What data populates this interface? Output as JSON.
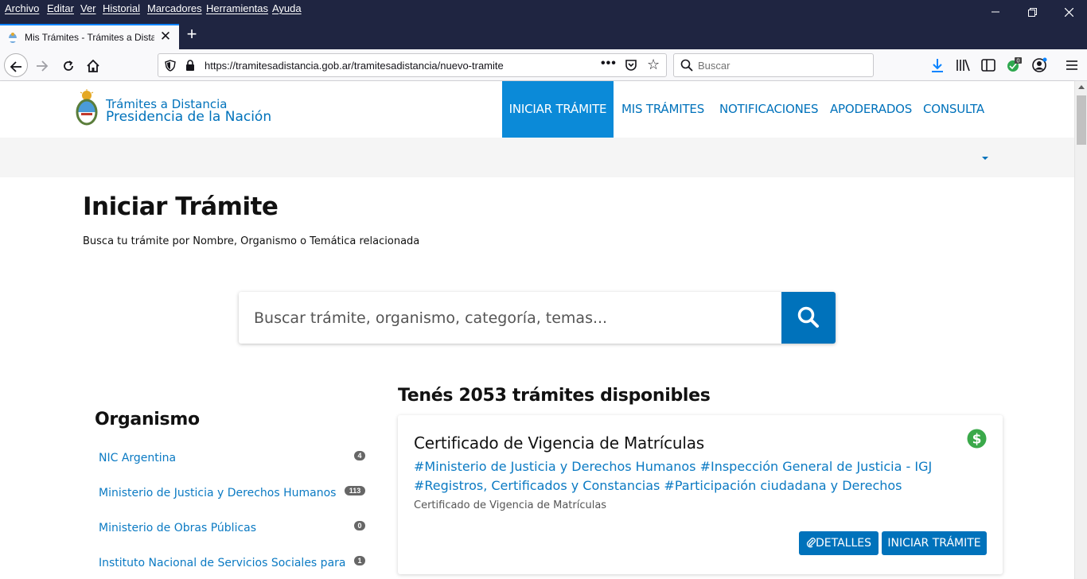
{
  "browser": {
    "menu": [
      "Archivo",
      "Editar",
      "Ver",
      "Historial",
      "Marcadores",
      "Herramientas",
      "Ayuda"
    ],
    "tab_title": "Mis Trámites - Trámites a Distancia",
    "url": "https://tramitesadistancia.gob.ar/tramitesadistancia/nuevo-tramite",
    "search_placeholder": "Buscar",
    "icons": [
      "back-icon",
      "forward-icon",
      "reload-icon",
      "home-icon",
      "shield-icon",
      "lock-icon",
      "pocket-icon",
      "star-icon",
      "download-icon",
      "library-icon",
      "sidebar-icon",
      "extension-icon",
      "account-icon",
      "menu-icon"
    ]
  },
  "header": {
    "logo_line1": "Trámites a Distancia",
    "logo_line2": "Presidencia de la Nación",
    "nav": [
      "INICIAR TRÁMITE",
      "MIS TRÁMITES",
      "NOTIFICACIONES",
      "APODERADOS",
      "CONSULTA"
    ],
    "active_nav": "INICIAR TRÁMITE"
  },
  "main": {
    "title": "Iniciar Trámite",
    "subtitle": "Busca tu trámite por Nombre, Organismo o Temática relacionada",
    "search_placeholder": "Buscar trámite, organismo, categoría, temas...",
    "results_heading": "Tenés 2053 trámites disponibles"
  },
  "filters": {
    "heading": "Organismo",
    "items": [
      {
        "label": "NIC Argentina",
        "count": "4"
      },
      {
        "label": "Ministerio de Justicia y Derechos Humanos",
        "count": "113"
      },
      {
        "label": "Ministerio de Obras Públicas",
        "count": "0"
      },
      {
        "label": "Instituto Nacional de Servicios Sociales para",
        "count": "1"
      }
    ]
  },
  "card": {
    "title": "Certificado de Vigencia de Matrículas",
    "tags": "#Ministerio de Justicia y Derechos Humanos #Inspección General de Justicia - IGJ #Registros, Certificados y Constancias #Participación ciudadana y Derechos",
    "description": "Certificado de Vigencia de Matrículas",
    "details_label": "DETALLES",
    "start_label": "INICIAR TRÁMITE"
  },
  "colors": {
    "brand_blue": "#0072bb",
    "active_nav_bg": "#0b8ad8",
    "chrome_dark": "#1f2541",
    "price_green": "#3aa94a"
  }
}
